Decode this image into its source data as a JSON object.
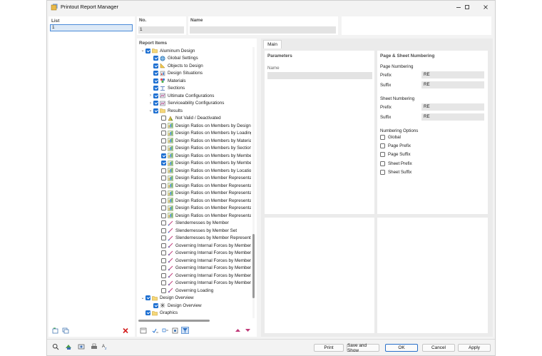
{
  "window": {
    "title": "Printout Report Manager"
  },
  "list": {
    "header": "List",
    "items": [
      "1"
    ]
  },
  "no": {
    "header": "No.",
    "value": "1"
  },
  "name": {
    "header": "Name",
    "value": ""
  },
  "report_items": {
    "header": "Report Items",
    "tree": [
      {
        "label": "Aluminum Design",
        "level": 0,
        "chev": "down",
        "checked": true,
        "icon": "folder-icon"
      },
      {
        "label": "Global Settings",
        "level": 1,
        "chev": "",
        "checked": true,
        "icon": "globe-icon"
      },
      {
        "label": "Objects to Design",
        "level": 1,
        "chev": "",
        "checked": true,
        "icon": "object-icon"
      },
      {
        "label": "Design Situations",
        "level": 1,
        "chev": "",
        "checked": true,
        "icon": "situation-icon"
      },
      {
        "label": "Materials",
        "level": 1,
        "chev": "",
        "checked": true,
        "icon": "material-icon"
      },
      {
        "label": "Sections",
        "level": 1,
        "chev": "",
        "checked": true,
        "icon": "section-icon"
      },
      {
        "label": "Ultimate Configurations",
        "level": 1,
        "chev": "right",
        "checked": true,
        "icon": "config-icon"
      },
      {
        "label": "Serviceability Configurations",
        "level": 1,
        "chev": "right",
        "checked": true,
        "icon": "config-icon"
      },
      {
        "label": "Results",
        "level": 1,
        "chev": "down",
        "checked": true,
        "icon": "folder-icon"
      },
      {
        "label": "Not Valid / Deactivated",
        "level": 2,
        "chev": "",
        "checked": false,
        "icon": "invalid-icon"
      },
      {
        "label": "Design Ratios on Members by Design",
        "level": 2,
        "chev": "",
        "checked": false,
        "icon": "ratio-icon"
      },
      {
        "label": "Design Ratios on Members by Loading",
        "level": 2,
        "chev": "",
        "checked": false,
        "icon": "ratio-icon"
      },
      {
        "label": "Design Ratios on Members by Materia",
        "level": 2,
        "chev": "",
        "checked": false,
        "icon": "ratio-icon"
      },
      {
        "label": "Design Ratios on Members by Section",
        "level": 2,
        "chev": "",
        "checked": false,
        "icon": "ratio-icon"
      },
      {
        "label": "Design Ratios on Members by Membe",
        "level": 2,
        "chev": "",
        "checked": true,
        "icon": "ratio-icon"
      },
      {
        "label": "Design Ratios on Members by Membe",
        "level": 2,
        "chev": "",
        "checked": true,
        "icon": "ratio-icon"
      },
      {
        "label": "Design Ratios on Members by Locatio",
        "level": 2,
        "chev": "",
        "checked": false,
        "icon": "ratio-icon"
      },
      {
        "label": "Design Ratios on Member Representa",
        "level": 2,
        "chev": "",
        "checked": false,
        "icon": "ratio-icon"
      },
      {
        "label": "Design Ratios on Member Representat",
        "level": 2,
        "chev": "",
        "checked": false,
        "icon": "ratio-icon"
      },
      {
        "label": "Design Ratios on Member Representat",
        "level": 2,
        "chev": "",
        "checked": false,
        "icon": "ratio-icon"
      },
      {
        "label": "Design Ratios on Member Representat",
        "level": 2,
        "chev": "",
        "checked": false,
        "icon": "ratio-icon"
      },
      {
        "label": "Design Ratios on Member Representat",
        "level": 2,
        "chev": "",
        "checked": false,
        "icon": "ratio-icon"
      },
      {
        "label": "Design Ratios on Member Representat",
        "level": 2,
        "chev": "",
        "checked": false,
        "icon": "ratio-icon"
      },
      {
        "label": "Slendernesses by Member",
        "level": 2,
        "chev": "",
        "checked": false,
        "icon": "slender-icon"
      },
      {
        "label": "Slendernesses by Member Set",
        "level": 2,
        "chev": "",
        "checked": false,
        "icon": "slender-icon"
      },
      {
        "label": "Slendernesses by Member Representa",
        "level": 2,
        "chev": "",
        "checked": false,
        "icon": "slender-icon"
      },
      {
        "label": "Governing Internal Forces by Member",
        "level": 2,
        "chev": "",
        "checked": false,
        "icon": "force-icon"
      },
      {
        "label": "Governing Internal Forces by Member",
        "level": 2,
        "chev": "",
        "checked": false,
        "icon": "force-icon"
      },
      {
        "label": "Governing Internal Forces by Member",
        "level": 2,
        "chev": "",
        "checked": false,
        "icon": "force-icon"
      },
      {
        "label": "Governing Internal Forces by Member",
        "level": 2,
        "chev": "",
        "checked": false,
        "icon": "force-icon"
      },
      {
        "label": "Governing Internal Forces by Member",
        "level": 2,
        "chev": "",
        "checked": false,
        "icon": "force-icon"
      },
      {
        "label": "Governing Internal Forces by Member",
        "level": 2,
        "chev": "",
        "checked": false,
        "icon": "force-icon"
      },
      {
        "label": "Governing Loading",
        "level": 2,
        "chev": "",
        "checked": false,
        "icon": "force-icon"
      },
      {
        "label": "Design Overview",
        "level": 0,
        "chev": "down",
        "checked": true,
        "icon": "folder-icon"
      },
      {
        "label": "Design Overview",
        "level": 1,
        "chev": "",
        "checked": true,
        "icon": "overview-icon"
      },
      {
        "label": "Graphics",
        "level": 0,
        "chev": "",
        "checked": true,
        "icon": "folder-icon"
      }
    ]
  },
  "tabs": {
    "main": "Main"
  },
  "parameters": {
    "header": "Parameters",
    "name_label": "Name",
    "name_value": ""
  },
  "numbering": {
    "header": "Page & Sheet Numbering",
    "page_header": "Page Numbering",
    "page_prefix_label": "Prefix",
    "page_prefix_value": "RE",
    "page_suffix_label": "Suffix",
    "page_suffix_value": "RE",
    "sheet_header": "Sheet Numbering",
    "sheet_prefix_label": "Prefix",
    "sheet_prefix_value": "RE",
    "sheet_suffix_label": "Suffix",
    "sheet_suffix_value": "RE",
    "options_header": "Numbering Options",
    "options": [
      "Global",
      "Page Prefix",
      "Page Suffix",
      "Sheet Prefix",
      "Sheet Suffix"
    ]
  },
  "buttons": {
    "print": "Print",
    "save_show": "Save and Show",
    "ok": "OK",
    "cancel": "Cancel",
    "apply": "Apply"
  }
}
